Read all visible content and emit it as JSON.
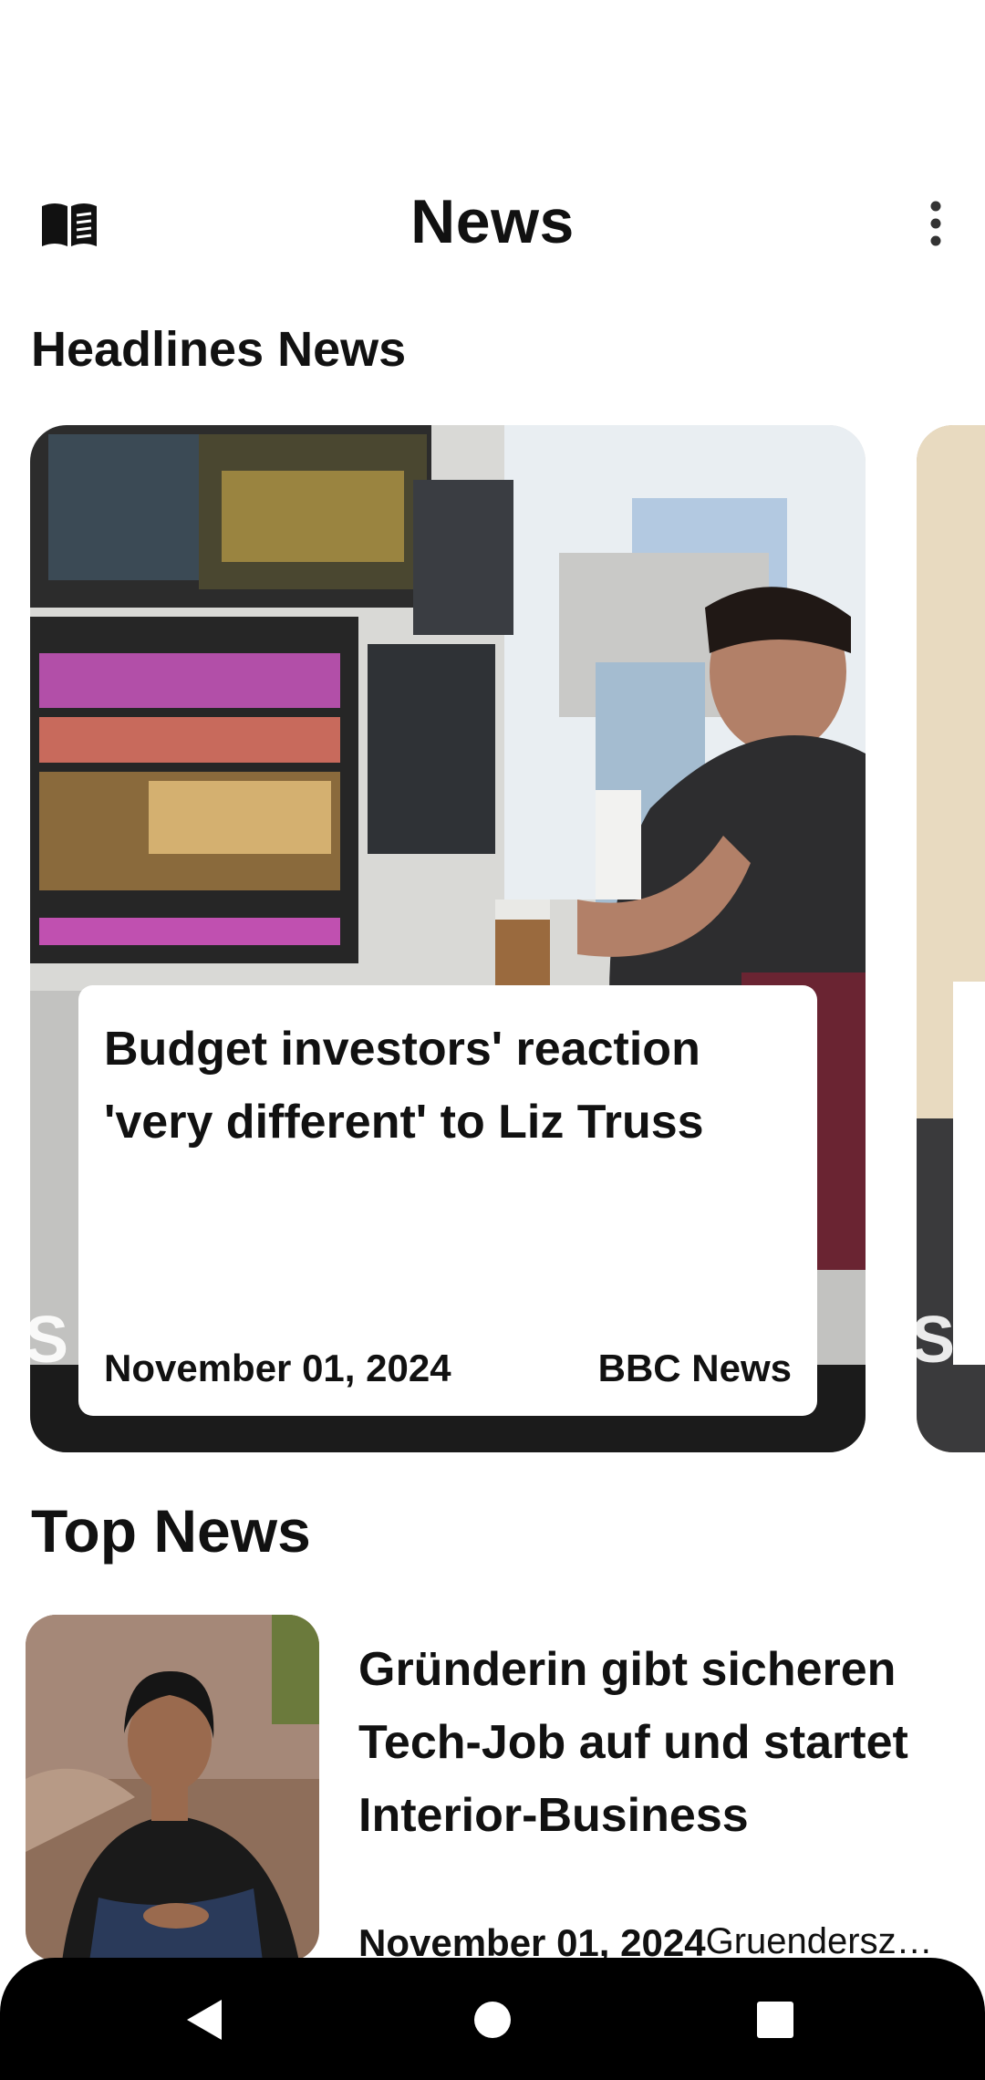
{
  "app_bar": {
    "title": "News",
    "left_icon": "menu-book-icon",
    "right_icon": "more-vertical-icon"
  },
  "headlines": {
    "section_title": "Headlines News",
    "cards": [
      {
        "title": "Budget investors' reaction 'very different' to Liz Truss",
        "date": "November 01, 2024",
        "source": "BBC News"
      }
    ]
  },
  "top_news": {
    "section_title": "Top News",
    "items": [
      {
        "title": "Gründerin gibt sicheren Tech-Job auf und startet Interior-Business",
        "date": "November 01, 2024",
        "source": "Gruenderszene"
      }
    ]
  },
  "nav_bar": {
    "back_icon": "back-triangle-icon",
    "home_icon": "home-circle-icon",
    "recents_icon": "recents-square-icon"
  }
}
